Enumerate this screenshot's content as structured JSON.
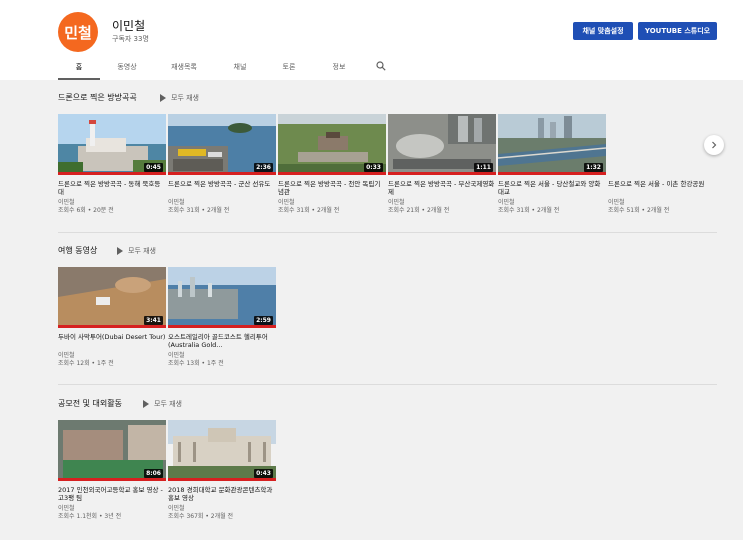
{
  "channel": {
    "avatar_text": "민철",
    "name": "이민철",
    "subscribers": "구독자 33명",
    "customize_label": "채널 맞춤설정",
    "studio_label": "YOUTUBE 스튜디오"
  },
  "tabs": [
    "홈",
    "동영상",
    "재생목록",
    "채널",
    "토론",
    "정보"
  ],
  "play_all_label": "모두 재생",
  "shelves": [
    {
      "title": "드론으로 찍은 방방곡곡",
      "videos": [
        {
          "title": "드론으로 찍은 방방곡곡 - 동해 묵호등대",
          "channel": "이민철",
          "meta": "조회수 6회 • 20분 전",
          "duration": "0:45"
        },
        {
          "title": "드론으로 찍은 방방곡곡 - 군산 선유도",
          "channel": "이민철",
          "meta": "조회수 31회 • 2개월 전",
          "duration": "2:36"
        },
        {
          "title": "드론으로 찍은 방방곡곡 - 천안 독립기념관",
          "channel": "이민철",
          "meta": "조회수 31회 • 2개월 전",
          "duration": "0:33"
        },
        {
          "title": "드론으로 찍은 방방곡곡 - 부산국제영화제",
          "channel": "이민철",
          "meta": "조회수 21회 • 2개월 전",
          "duration": "1:11"
        },
        {
          "title": "드론으로 찍은 서울 - 당산철교와 양화대교",
          "channel": "이민철",
          "meta": "조회수 31회 • 2개월 전",
          "duration": "1:32"
        },
        {
          "title": "드론으로 찍은 서울 - 이촌 한강공원",
          "channel": "이민철",
          "meta": "조회수 51회 • 2개월 전",
          "duration": ""
        }
      ]
    },
    {
      "title": "여행 동영상",
      "videos": [
        {
          "title": "두바이 사막투어(Dubai Desert Tour)",
          "channel": "이민철",
          "meta": "조회수 12회 • 1주 전",
          "duration": "3:41"
        },
        {
          "title": "오스트레일리아 골드코스트 헬리투어(Australia Gold...",
          "channel": "이민철",
          "meta": "조회수 13회 • 1주 전",
          "duration": "2:59"
        }
      ]
    },
    {
      "title": "공모전 및 대외활동",
      "videos": [
        {
          "title": "2017 인천외국어고등학교 홍보 영상 - 고3팽 팀",
          "channel": "이민철",
          "meta": "조회수 1.1천회 • 3년 전",
          "duration": "8:06"
        },
        {
          "title": "2018 경희대학교 문화관광콘텐츠학과 홍보 영상",
          "channel": "이민철",
          "meta": "조회수 367회 • 2개월 전",
          "duration": "0:43"
        }
      ]
    }
  ]
}
